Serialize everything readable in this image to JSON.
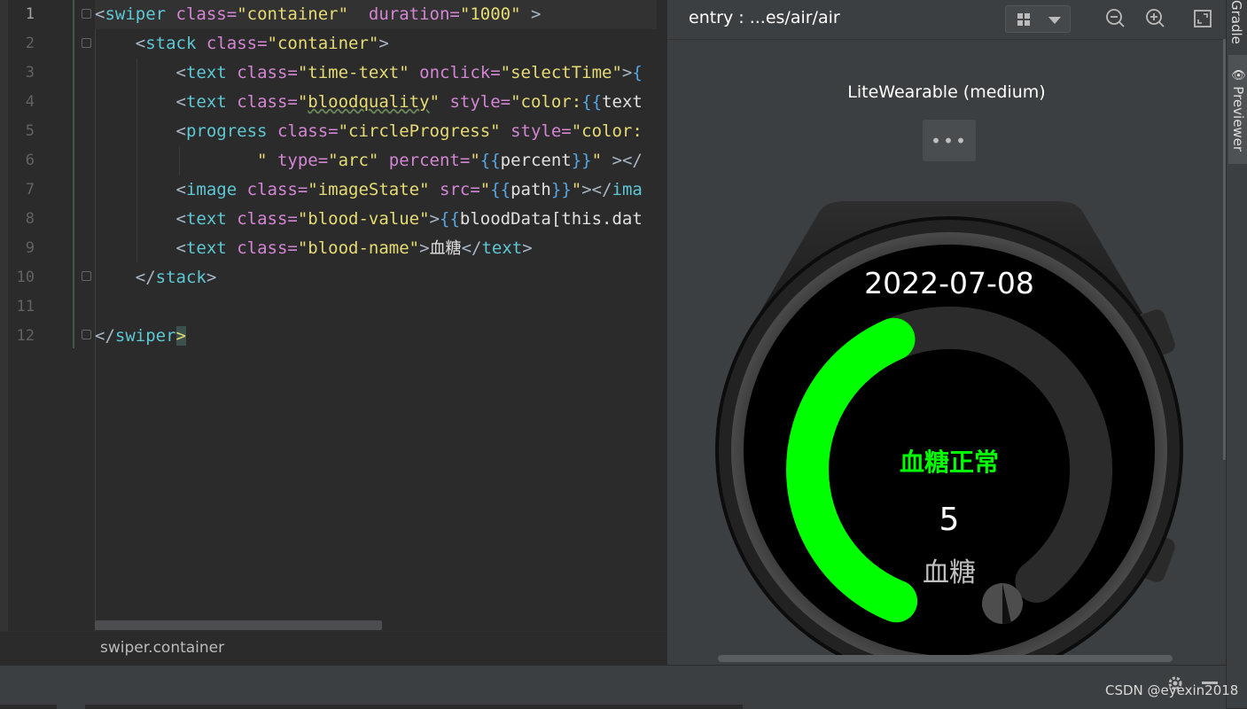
{
  "editor": {
    "line_numbers": [
      "1",
      "2",
      "3",
      "4",
      "5",
      "6",
      "7",
      "8",
      "9",
      "10",
      "11",
      "12"
    ],
    "inspection_count": "1",
    "breadcrumb": "swiper.container",
    "lines": {
      "l1": {
        "lt": "<",
        "tag": "swiper",
        "a1": "class=",
        "v1": "\"container\"",
        "a2": "duration=",
        "v2": "\"1000\"",
        "gt": " >"
      },
      "l2": {
        "lt": "<",
        "tag": "stack",
        "a1": "class=",
        "v1": "\"container\"",
        "gt": ">"
      },
      "l3": {
        "lt": "<",
        "tag": "text",
        "a1": "class=",
        "v1": "\"time-text\"",
        "a2": "onclick=",
        "v2": "\"selectTime\"",
        "gt": ">",
        "mb": "{"
      },
      "l4": {
        "lt": "<",
        "tag": "text",
        "a1": "class=",
        "v1": "\"",
        "v1b": "bloodquality",
        "v1c": "\"",
        "a2": "style=",
        "v2": "\"color:",
        "mb": "{{",
        "rest": "text"
      },
      "l5": {
        "lt": "<",
        "tag": "progress",
        "a1": "class=",
        "v1": "\"circleProgress\"",
        "a2": "style=",
        "v2": "\"color:"
      },
      "l6": {
        "q": "\"",
        "a1": "type=",
        "v1": "\"arc\"",
        "a2": "percent=",
        "v2": "\"",
        "mb1": "{{",
        "var": "percent",
        "mb2": "}}",
        "v3": "\"",
        "rest": " ></"
      },
      "l7": {
        "lt": "<",
        "tag": "image",
        "a1": "class=",
        "v1": "\"imageState\"",
        "a2": "src=",
        "v2": "\"",
        "mb1": "{{",
        "var": "path",
        "mb2": "}}",
        "v3": "\"",
        "rest": "></",
        "tag2": "ima"
      },
      "l8": {
        "lt": "<",
        "tag": "text",
        "a1": "class=",
        "v1": "\"blood-value\"",
        "gt": ">",
        "mb": "{{",
        "rest": "bloodData[this.dat"
      },
      "l9": {
        "lt": "<",
        "tag": "text",
        "a1": "class=",
        "v1": "\"blood-name\"",
        "gt": ">",
        "zh": "血糖",
        "close": "</",
        "tag2": "text",
        "gt2": ">"
      },
      "l10": {
        "close": "</",
        "tag": "stack",
        "gt": ">"
      },
      "l12": {
        "close": "</",
        "tag": "swiper",
        "gt": ">"
      }
    }
  },
  "previewer": {
    "title": "entry : ...es/air/air",
    "device": "LiteWearable (medium)",
    "more": "•••",
    "watch": {
      "date": "2022-07-08",
      "status": "血糖正常",
      "value": "5",
      "label": "血糖",
      "progress_percent": 45,
      "accent": "#00ff00"
    }
  },
  "side_tabs": {
    "gradle": "Gradle",
    "previewer": "Previewer"
  },
  "watermark": "CSDN @eyexin2018",
  "colors": {
    "editor_bg": "#2b2b2b",
    "panel_bg": "#3c3f41",
    "tag": "#5ec8d4",
    "attr": "#d486d4",
    "string": "#e6db74"
  }
}
